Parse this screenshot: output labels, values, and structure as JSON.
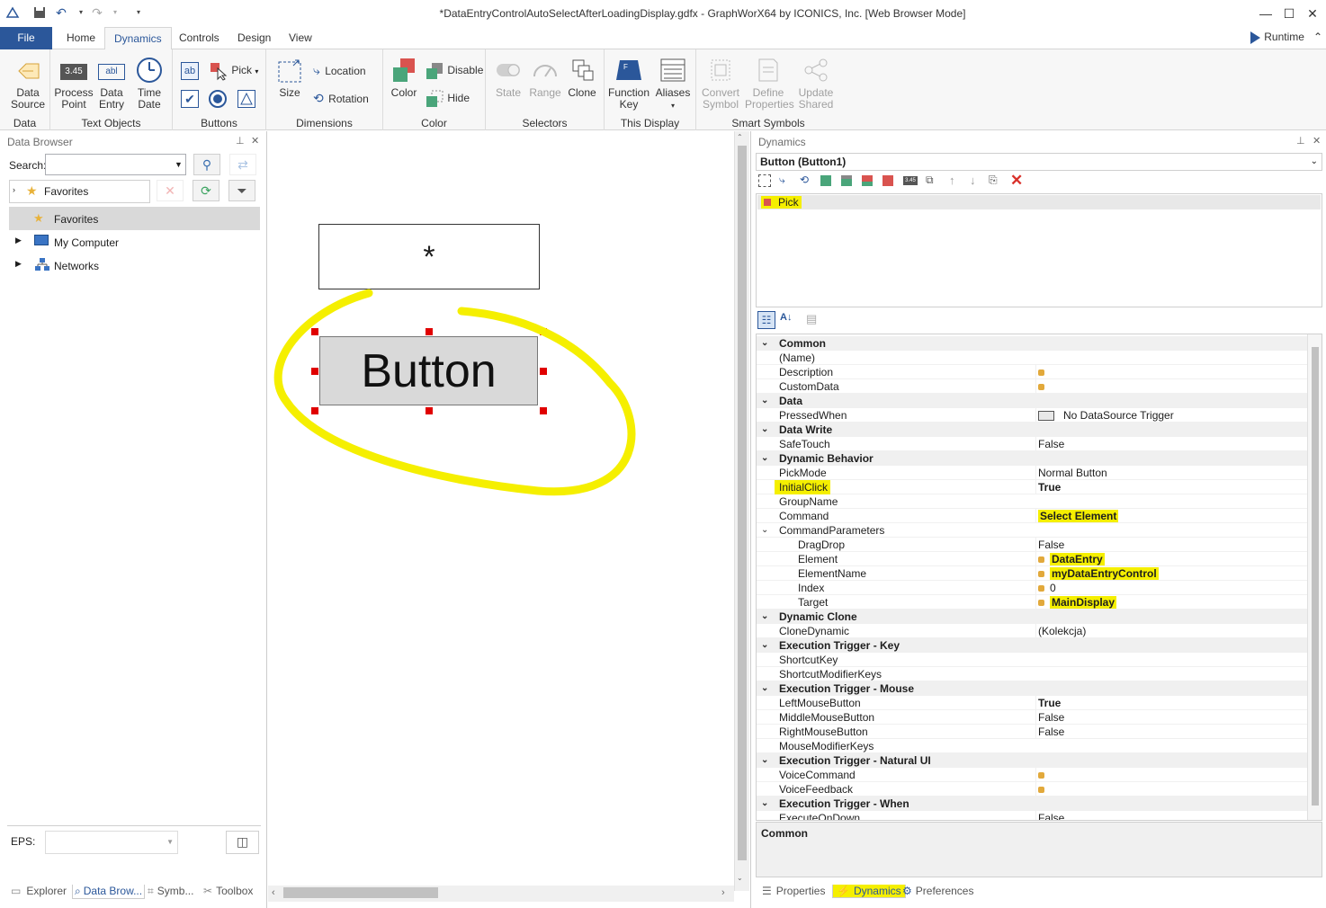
{
  "window": {
    "title": "*DataEntryControlAutoSelectAfterLoadingDisplay.gdfx - GraphWorX64 by ICONICS, Inc. [Web Browser Mode]",
    "minimize": "—",
    "maximize": "☐",
    "close": "✕"
  },
  "ribbon": {
    "tabs": [
      "File",
      "Home",
      "Dynamics",
      "Controls",
      "Design",
      "View"
    ],
    "active_tab": "Dynamics",
    "runtime_label": "Runtime",
    "groups": {
      "data": {
        "label": "Data",
        "data_source": "Data\nSource"
      },
      "text_objects": {
        "label": "Text Objects",
        "process_point": "Process\nPoint",
        "data_entry": "Data\nEntry",
        "time_date": "Time\nDate",
        "process_point_icon_text": "3.45",
        "data_entry_icon_text": "abl"
      },
      "buttons": {
        "label": "Buttons",
        "pick": "Pick"
      },
      "dimensions": {
        "label": "Dimensions",
        "size": "Size",
        "location": "Location",
        "rotation": "Rotation"
      },
      "color": {
        "label": "Color",
        "color": "Color",
        "disable": "Disable",
        "hide": "Hide"
      },
      "selectors": {
        "label": "Selectors",
        "state": "State",
        "range": "Range",
        "clone": "Clone"
      },
      "this_display": {
        "label": "This Display",
        "function_key": "Function\nKey",
        "aliases": "Aliases"
      },
      "smart_symbols": {
        "label": "Smart Symbols",
        "convert_symbol": "Convert\nSymbol",
        "define_properties": "Define\nProperties",
        "update_shared": "Update\nShared"
      }
    }
  },
  "data_browser": {
    "title": "Data Browser",
    "search_label": "Search:",
    "search_value": "",
    "favorites_combo": "Favorites",
    "tree": [
      {
        "label": "Favorites",
        "selected": true
      },
      {
        "label": "My Computer"
      },
      {
        "label": "Networks"
      }
    ],
    "eps_label": "EPS:",
    "bottom_tabs": [
      "Explorer",
      "Data Brow...",
      "Symb...",
      "Toolbox"
    ]
  },
  "canvas": {
    "data_entry_text": "*",
    "button_text": "Button"
  },
  "dynamics_panel": {
    "title": "Dynamics",
    "object": "Button (Button1)",
    "dynamics_list": [
      "Pick"
    ],
    "properties": [
      {
        "type": "cat",
        "name": "Common"
      },
      {
        "name": "(Name)",
        "value": ""
      },
      {
        "name": "Description",
        "value": "",
        "dot": true
      },
      {
        "name": "CustomData",
        "value": "",
        "dot": true
      },
      {
        "type": "cat",
        "name": "Data"
      },
      {
        "name": "PressedWhen",
        "value": "No DataSource Trigger",
        "swatch": true
      },
      {
        "type": "cat",
        "name": "Data Write"
      },
      {
        "name": "SafeTouch",
        "value": "False"
      },
      {
        "type": "cat",
        "name": "Dynamic Behavior"
      },
      {
        "name": "PickMode",
        "value": "Normal Button"
      },
      {
        "name": "InitialClick",
        "value": "True",
        "bold": true,
        "hl": true
      },
      {
        "name": "GroupName",
        "value": ""
      },
      {
        "name": "Command",
        "value": "Select Element",
        "bold": true,
        "hlv": true
      },
      {
        "name": "CommandParameters",
        "value": "",
        "expander": true
      },
      {
        "name": "DragDrop",
        "value": "False",
        "sub": true
      },
      {
        "name": "Element",
        "value": "DataEntry",
        "sub": true,
        "dot": true,
        "bold": true,
        "hlv": true
      },
      {
        "name": "ElementName",
        "value": "myDataEntryControl",
        "sub": true,
        "dot": true,
        "bold": true,
        "hlv": true
      },
      {
        "name": "Index",
        "value": "0",
        "sub": true,
        "dot": true
      },
      {
        "name": "Target",
        "value": "MainDisplay",
        "sub": true,
        "dot": true,
        "bold": true,
        "hlv": true
      },
      {
        "type": "cat",
        "name": "Dynamic Clone"
      },
      {
        "name": "CloneDynamic",
        "value": "(Kolekcja)"
      },
      {
        "type": "cat",
        "name": "Execution Trigger - Key"
      },
      {
        "name": "ShortcutKey",
        "value": ""
      },
      {
        "name": "ShortcutModifierKeys",
        "value": ""
      },
      {
        "type": "cat",
        "name": "Execution Trigger - Mouse"
      },
      {
        "name": "LeftMouseButton",
        "value": "True",
        "bold": true
      },
      {
        "name": "MiddleMouseButton",
        "value": "False"
      },
      {
        "name": "RightMouseButton",
        "value": "False"
      },
      {
        "name": "MouseModifierKeys",
        "value": ""
      },
      {
        "type": "cat",
        "name": "Execution Trigger - Natural UI"
      },
      {
        "name": "VoiceCommand",
        "value": "",
        "dot": true
      },
      {
        "name": "VoiceFeedback",
        "value": "",
        "dot": true
      },
      {
        "type": "cat",
        "name": "Execution Trigger - When"
      },
      {
        "name": "ExecuteOnDown",
        "value": "False"
      }
    ],
    "description_title": "Common",
    "bottom_tabs": [
      "Properties",
      "Dynamics",
      "Preferences"
    ]
  },
  "colors": {
    "accent": "#2b579a",
    "highlight": "#f5ef00",
    "selection_handle": "#e00000"
  }
}
